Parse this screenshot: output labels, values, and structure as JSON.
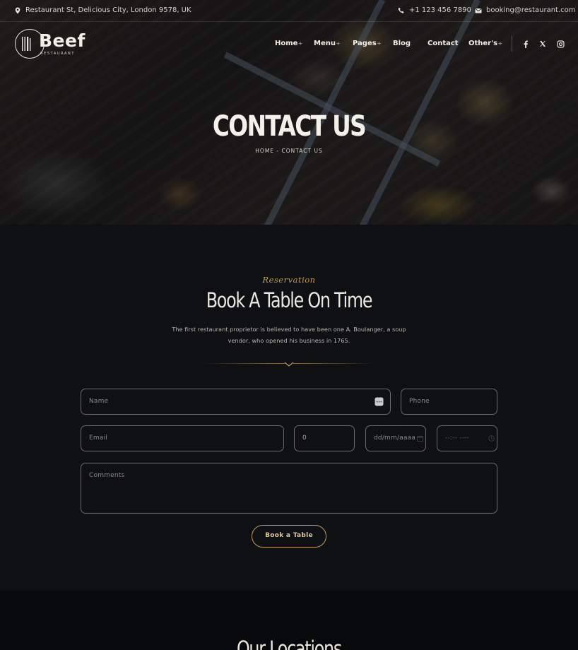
{
  "topbar": {
    "address": "Restaurant St, Delicious City, London 9578, UK",
    "phone": "+1 123 456 7890",
    "email": "booking@restaurant.com"
  },
  "logo": {
    "name": "Beef",
    "tagline": "RESTAURANT"
  },
  "nav": {
    "items": [
      {
        "label": "Home",
        "has_submenu": true
      },
      {
        "label": "Menu",
        "has_submenu": true
      },
      {
        "label": "Pages",
        "has_submenu": true
      },
      {
        "label": "Blog",
        "has_submenu": false
      },
      {
        "label": "Contact",
        "has_submenu": false
      },
      {
        "label": "Other's",
        "has_submenu": true
      }
    ],
    "social": [
      "facebook-icon",
      "x-icon",
      "instagram-icon"
    ]
  },
  "hero": {
    "title": "CONTACT US",
    "breadcrumb": "HOME - CONTACT US"
  },
  "reservation": {
    "kicker": "Reservation",
    "heading": "Book A Table On Time",
    "description": "The first restaurant proprietor is believed to have been one A. Boulanger, a soup vendor, who opened his business in 1765.",
    "fields": {
      "name_placeholder": "Name",
      "phone_placeholder": "Phone",
      "email_placeholder": "Email",
      "guests_value": "0",
      "date_placeholder": "dd/mm/aaaa",
      "time_placeholder": "--:-- ----",
      "comments_placeholder": "Comments"
    },
    "button_label": "Book a Table"
  },
  "locations": {
    "heading": "Our Locations"
  },
  "colors": {
    "accent": "#c49a5a",
    "background": "#0e1014",
    "text": "#ece8e0"
  }
}
